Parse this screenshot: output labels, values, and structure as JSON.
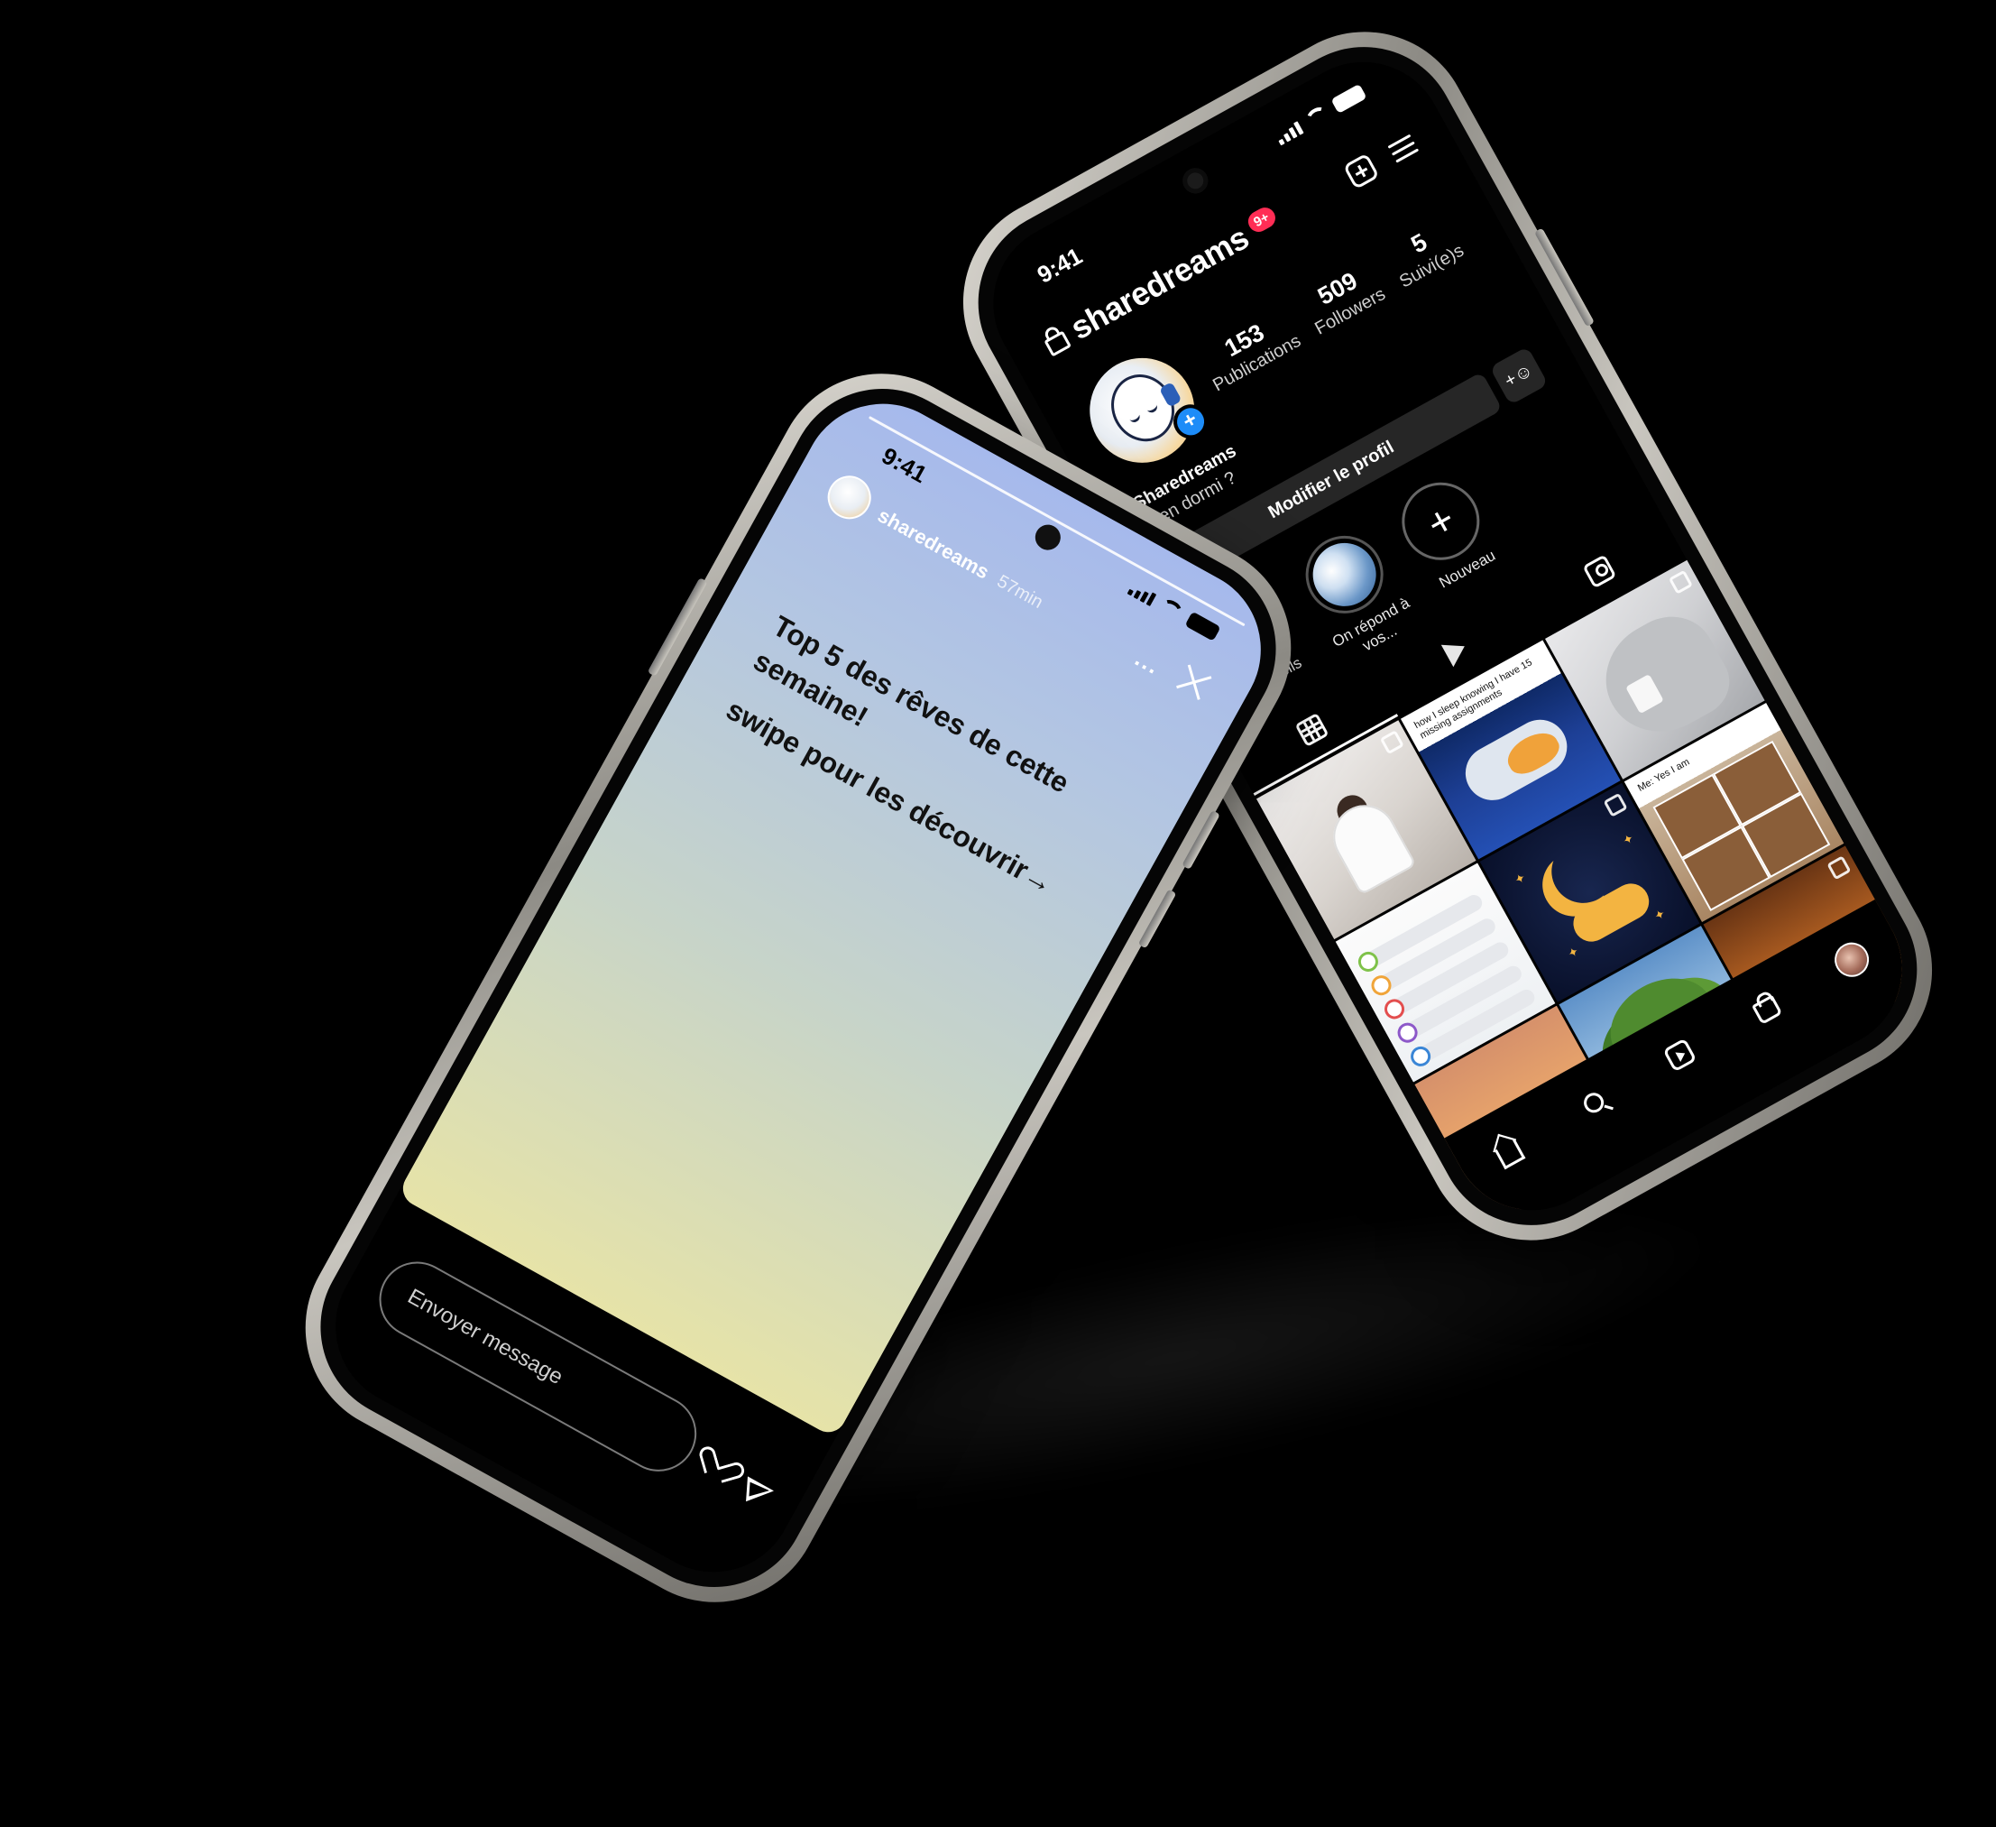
{
  "colors": {
    "background": "#000000",
    "phone_frame": "#c9c6bf",
    "notification_badge": "#ff2d55",
    "story_gradient_top": "#a6b9ec",
    "story_gradient_bottom": "#e6e3a8",
    "action_button": "#262626"
  },
  "profile_phone": {
    "status_bar": {
      "time": "9:41"
    },
    "header": {
      "username": "sharedreams",
      "notification_badge": "9+",
      "icons": [
        "lock-icon",
        "add-post-icon",
        "menu-icon"
      ]
    },
    "stats": [
      {
        "value": "153",
        "label": "Publications"
      },
      {
        "value": "509",
        "label": "Followers"
      },
      {
        "value": "5",
        "label": "Suivi(e)s"
      }
    ],
    "bio": {
      "name": "Sharedreams",
      "tagline": "Bien dormi ?"
    },
    "actions": {
      "edit_profile": "Modifier le profil",
      "discover_icon": "add-person-icon"
    },
    "highlights": [
      {
        "label": "Conseils",
        "icon": "highlight-cover"
      },
      {
        "label": "On répond à vos...",
        "icon": "highlight-cover"
      },
      {
        "label": "Nouveau",
        "icon": "plus-icon"
      }
    ],
    "tabs": [
      {
        "name": "grid",
        "icon": "grid-icon",
        "active": true
      },
      {
        "name": "reels",
        "icon": "reels-icon",
        "active": false
      },
      {
        "name": "tagged",
        "icon": "tagged-icon",
        "active": false
      }
    ],
    "posts": [
      {
        "caption": ""
      },
      {
        "caption": "how I sleep knowing I have 15 missing assignments"
      },
      {
        "caption": ""
      },
      {
        "caption": ""
      },
      {
        "caption": ""
      },
      {
        "caption": "Me: Yes I am"
      },
      {
        "caption": ""
      },
      {
        "caption": ""
      },
      {
        "caption": ""
      }
    ],
    "bottom_nav": [
      "home-icon",
      "search-icon",
      "reels-icon",
      "shop-icon",
      "profile-avatar"
    ]
  },
  "story_phone": {
    "status_bar": {
      "time": "9:41"
    },
    "author": {
      "username": "sharedreams",
      "age": "57min"
    },
    "more_label": "...",
    "text_lines": [
      "Top 5 des rêves de cette semaine!",
      "swipe pour les découvrir→"
    ],
    "message_placeholder": "Envoyer message",
    "icons": [
      "heart-icon",
      "send-icon",
      "close-icon"
    ]
  }
}
